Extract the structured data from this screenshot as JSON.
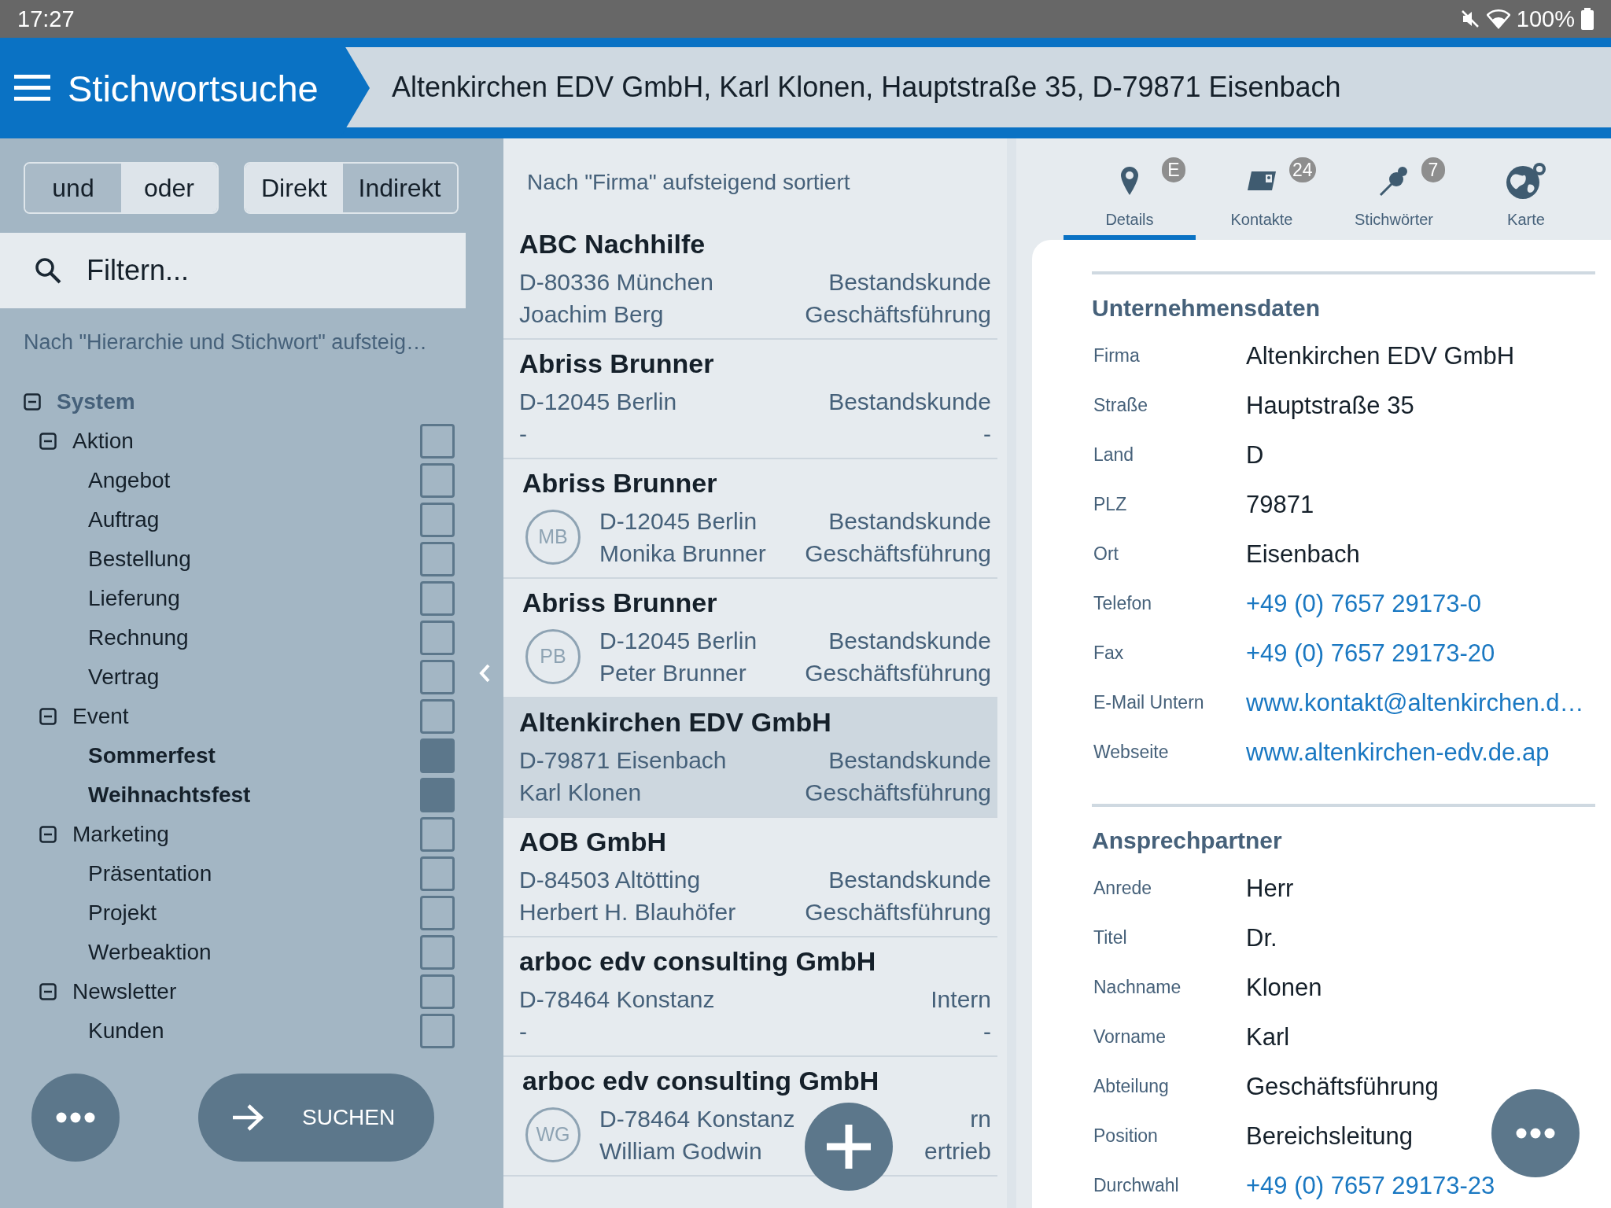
{
  "status_bar": {
    "time": "17:27",
    "battery": "100%"
  },
  "header": {
    "title": "Stichwortsuche",
    "breadcrumb": "Altenkirchen EDV GmbH, Karl Klonen, Hauptstraße 35, D-79871 Eisenbach"
  },
  "filter_panel": {
    "toggle_groups": [
      [
        {
          "label": "und",
          "selected": true
        },
        {
          "label": "oder",
          "selected": false
        }
      ],
      [
        {
          "label": "Direkt",
          "selected": false
        },
        {
          "label": "Indirekt",
          "selected": true
        }
      ]
    ],
    "search": {
      "placeholder": "Filtern..."
    },
    "sort_info": "Nach \"Hierarchie und Stichwort\" aufsteig…",
    "tree": [
      {
        "label": "System",
        "expanded": true,
        "children": [
          {
            "label": "Aktion",
            "expanded": true,
            "checked": false,
            "children": [
              {
                "label": "Angebot",
                "checked": false
              },
              {
                "label": "Auftrag",
                "checked": false
              },
              {
                "label": "Bestellung",
                "checked": false
              },
              {
                "label": "Lieferung",
                "checked": false
              },
              {
                "label": "Rechnung",
                "checked": false
              },
              {
                "label": "Vertrag",
                "checked": false
              }
            ]
          },
          {
            "label": "Event",
            "expanded": true,
            "checked": false,
            "children": [
              {
                "label": "Sommerfest",
                "checked": true
              },
              {
                "label": "Weihnachtsfest",
                "checked": true
              }
            ]
          },
          {
            "label": "Marketing",
            "expanded": true,
            "checked": false,
            "children": [
              {
                "label": "Präsentation",
                "checked": false
              },
              {
                "label": "Projekt",
                "checked": false
              },
              {
                "label": "Werbeaktion",
                "checked": false
              }
            ]
          },
          {
            "label": "Newsletter",
            "expanded": true,
            "checked": false,
            "children": [
              {
                "label": "Kunden",
                "checked": false
              }
            ]
          }
        ]
      }
    ],
    "search_button": "SUCHEN"
  },
  "result_list": {
    "sort_info": "Nach \"Firma\" aufsteigend sortiert",
    "items": [
      {
        "kind": "company",
        "title": "ABC Nachhilfe",
        "left": [
          "D-80336 München",
          "Joachim Berg"
        ],
        "right": [
          "Bestandskunde",
          "Geschäftsführung"
        ],
        "selected": false
      },
      {
        "kind": "company",
        "title": "Abriss Brunner",
        "left": [
          "D-12045 Berlin",
          "-"
        ],
        "right": [
          "Bestandskunde",
          "-"
        ],
        "selected": false
      },
      {
        "kind": "contact",
        "title": "Abriss Brunner",
        "initials": "MB",
        "left": [
          "D-12045 Berlin",
          "Monika Brunner"
        ],
        "right": [
          "Bestandskunde",
          "Geschäftsführung"
        ],
        "selected": false
      },
      {
        "kind": "contact",
        "title": "Abriss Brunner",
        "initials": "PB",
        "left": [
          "D-12045 Berlin",
          "Peter Brunner"
        ],
        "right": [
          "Bestandskunde",
          "Geschäftsführung"
        ],
        "selected": false
      },
      {
        "kind": "company",
        "title": "Altenkirchen EDV GmbH",
        "left": [
          "D-79871 Eisenbach",
          "Karl Klonen"
        ],
        "right": [
          "Bestandskunde",
          "Geschäftsführung"
        ],
        "selected": true
      },
      {
        "kind": "company",
        "title": "AOB GmbH",
        "left": [
          "D-84503 Altötting",
          "Herbert H. Blauhöfer"
        ],
        "right": [
          "Bestandskunde",
          "Geschäftsführung"
        ],
        "selected": false
      },
      {
        "kind": "company",
        "title": "arboc edv consulting GmbH",
        "left": [
          "D-78464 Konstanz",
          "-"
        ],
        "right": [
          "Intern",
          "-"
        ],
        "selected": false
      },
      {
        "kind": "contact",
        "title": "arboc edv consulting GmbH",
        "initials": "WG",
        "left": [
          "D-78464 Konstanz",
          "William Godwin"
        ],
        "right": [
          "rn",
          "ertrieb"
        ],
        "selected": false
      }
    ]
  },
  "detail": {
    "tabs": [
      {
        "kind": "pin",
        "label": "Details",
        "badge": "E",
        "selected": true
      },
      {
        "kind": "card",
        "label": "Kontakte",
        "badge": "24",
        "selected": false
      },
      {
        "kind": "pushpin",
        "label": "Stichwörter",
        "badge": "7",
        "selected": false
      },
      {
        "kind": "globe",
        "label": "Karte",
        "selected": false
      }
    ],
    "sections": [
      {
        "title": "Unternehmensdaten",
        "fields": [
          {
            "label": "Firma",
            "value": "Altenkirchen EDV GmbH",
            "kind": "text"
          },
          {
            "label": "Straße",
            "value": "Hauptstraße 35",
            "kind": "text"
          },
          {
            "label": "Land",
            "value": "D",
            "kind": "text"
          },
          {
            "label": "PLZ",
            "value": "79871",
            "kind": "text"
          },
          {
            "label": "Ort",
            "value": "Eisenbach",
            "kind": "text"
          },
          {
            "label": "Telefon",
            "value": "+49 (0) 7657 29173-0",
            "kind": "link"
          },
          {
            "label": "Fax",
            "value": "+49 (0) 7657 29173-20",
            "kind": "link"
          },
          {
            "label": "E-Mail Untern",
            "value": "www.kontakt@altenkirchen.d…",
            "kind": "link"
          },
          {
            "label": "Webseite",
            "value": "www.altenkirchen-edv.de.ap",
            "kind": "link"
          }
        ]
      },
      {
        "title": "Ansprechpartner",
        "fields": [
          {
            "label": "Anrede",
            "value": "Herr",
            "kind": "text"
          },
          {
            "label": "Titel",
            "value": "Dr.",
            "kind": "text"
          },
          {
            "label": "Nachname",
            "value": "Klonen",
            "kind": "text"
          },
          {
            "label": "Vorname",
            "value": "Karl",
            "kind": "text"
          },
          {
            "label": "Abteilung",
            "value": "Geschäftsführung",
            "kind": "text"
          },
          {
            "label": "Position",
            "value": "Bereichsleitung",
            "kind": "text"
          },
          {
            "label": "Durchwahl",
            "value": "+49 (0) 7657 29173-23",
            "kind": "link"
          }
        ]
      }
    ]
  }
}
